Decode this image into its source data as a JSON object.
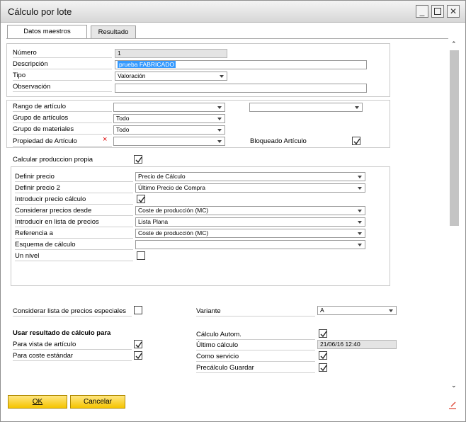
{
  "window": {
    "title": "Cálculo por lote"
  },
  "tabs": [
    "Datos maestros",
    "Resultado"
  ],
  "header_fields": {
    "numero": {
      "label": "Número",
      "value": "1"
    },
    "descripcion": {
      "label": "Descripción",
      "value": "prueba FABRICADO"
    },
    "tipo": {
      "label": "Tipo",
      "value": "Valoración"
    },
    "observacion": {
      "label": "Observación",
      "value": ""
    }
  },
  "filters": {
    "rango_articulo": {
      "label": "Rango de artículo",
      "from": "",
      "to": ""
    },
    "grupo_articulos": {
      "label": "Grupo de artículos",
      "value": "Todo"
    },
    "grupo_materiales": {
      "label": "Grupo de materiales",
      "value": "Todo"
    },
    "propiedad_articulo": {
      "label": "Propiedad de Artículo",
      "value": ""
    },
    "bloqueado_articulo": {
      "label": "Bloqueado Artículo",
      "checked": true
    }
  },
  "calc_prod": {
    "label": "Calcular produccion propia",
    "checked": true
  },
  "pricing": {
    "definir_precio": {
      "label": "Definir precio",
      "value": "Precio de Cálculo"
    },
    "definir_precio_2": {
      "label": "Definir precio 2",
      "value": "Último Precio de Compra"
    },
    "introducir_precio_calculo": {
      "label": "Introducir precio cálculo",
      "checked": true
    },
    "considerar_precios_desde": {
      "label": "Considerar precios desde",
      "value": "Coste de producción (MC)"
    },
    "introducir_lista_precios": {
      "label": "Introducir en lista de precios",
      "value": "Lista Plana"
    },
    "referencia_a": {
      "label": "Referencia a",
      "value": "Coste de producción (MC)"
    },
    "esquema_calculo": {
      "label": "Esquema de cálculo",
      "value": ""
    },
    "un_nivel": {
      "label": "Un nivel",
      "checked": false
    }
  },
  "special": {
    "considerar_lista_especial": {
      "label": "Considerar lista de precios especiales",
      "checked": false
    },
    "variante": {
      "label": "Variante",
      "value": "A"
    }
  },
  "usar_resultado": {
    "heading": "Usar resultado de cálculo para",
    "vista_articulo": {
      "label": "Para vista de artículo",
      "checked": true
    },
    "coste_estandar": {
      "label": "Para coste estándar",
      "checked": true
    }
  },
  "auto": {
    "calculo_autom": {
      "label": "Cálculo Autom.",
      "checked": true
    },
    "ultimo_calculo": {
      "label": "Último cálculo",
      "value": "21/06/16 12:40"
    },
    "como_servicio": {
      "label": "Como servicio",
      "checked": true
    },
    "precalculo_guardar": {
      "label": "Precálculo Guardar",
      "checked": true
    }
  },
  "buttons": {
    "ok": "OK",
    "cancel": "Cancelar"
  },
  "icons": {
    "required": "red-x-icon",
    "resize": "resize-grip-icon"
  }
}
